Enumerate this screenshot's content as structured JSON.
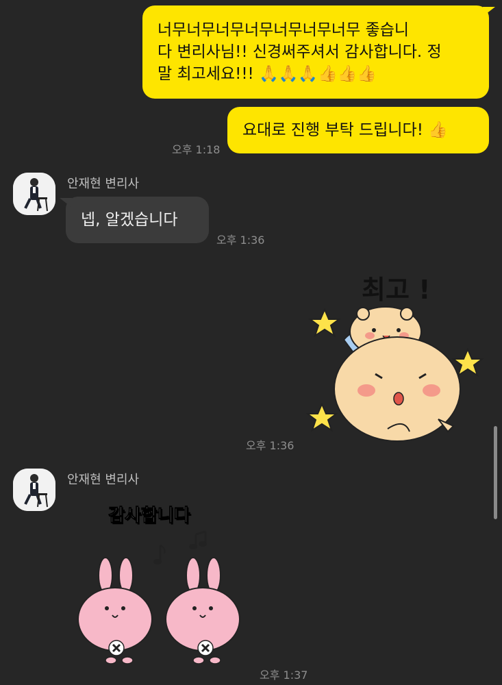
{
  "messages": {
    "m1": {
      "lines": [
        "너무너무너무너무너무너무너무 좋습니",
        "다 변리사님!! 신경써주셔서 감사합니다. 정",
        "말 최고세요!!! 🙏🙏🙏👍👍👍"
      ]
    },
    "m2": {
      "text": "요대로 진행 부탁 드립니다! 👍"
    },
    "m2_time": "오후 1:18",
    "sender_name_1": "안재현 변리사",
    "m3": {
      "text": "넵, 알겠습니다"
    },
    "m3_time": "오후 1:36",
    "sticker1": {
      "text": "최고 !"
    },
    "sticker1_time": "오후 1:36",
    "sender_name_2": "안재현 변리사",
    "sticker2": {
      "text": "감사합니다"
    },
    "sticker2_time": "오후 1:37"
  },
  "colors": {
    "background": "#262626",
    "my_bubble": "#fee500",
    "other_bubble": "#3b3b3b"
  },
  "icons": [
    "praying-hands-emoji",
    "thumbs-up-emoji",
    "avatar-photo",
    "music-note-icon",
    "star-icon"
  ]
}
